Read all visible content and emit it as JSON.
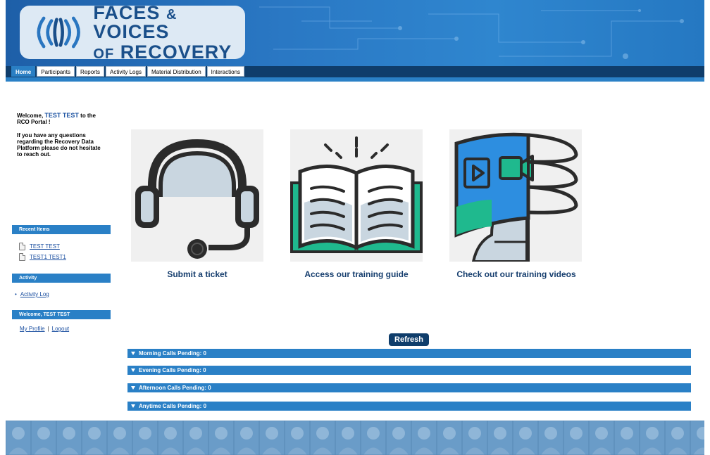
{
  "header": {
    "logo_line1": "FACES",
    "logo_amp": "&",
    "logo_line1b": "VOICES",
    "logo_of": "OF",
    "logo_line2": "RECOVERY"
  },
  "nav": {
    "tabs": [
      {
        "label": "Home",
        "active": true
      },
      {
        "label": "Participants"
      },
      {
        "label": "Reports"
      },
      {
        "label": "Activity Logs"
      },
      {
        "label": "Material Distribution"
      },
      {
        "label": "Interactions"
      }
    ]
  },
  "sidebar": {
    "welcome_prefix": "Welcome, ",
    "welcome_name": "TEST TEST",
    "welcome_suffix": " to the RCO Portal !",
    "help_text": "If you have any questions regarding the Recovery Data Platform please do not hesitate to reach out.",
    "recent_title": "Recent Items",
    "recent_items": [
      "TEST TEST",
      "TEST1 TEST1"
    ],
    "activity_title": "Activity",
    "activity_link": "Activity Log",
    "user_title": "Welcome, TEST TEST",
    "my_profile": "My Profile",
    "separator": "|",
    "logout": "Logout"
  },
  "cards": [
    {
      "label": "Submit a ticket",
      "icon": "headset-icon"
    },
    {
      "label": "Access our training guide",
      "icon": "book-icon"
    },
    {
      "label": "Check out our training videos",
      "icon": "video-icon"
    }
  ],
  "calls": {
    "refresh_label": "Refresh",
    "sections": [
      "Morning Calls Pending: 0",
      "Evening Calls Pending: 0",
      "Afternoon Calls Pending: 0",
      "Anytime Calls Pending: 0"
    ]
  },
  "colors": {
    "primary_blue": "#2a80c6",
    "dark_navy": "#0f3d6b",
    "accent_teal": "#1fb98e"
  }
}
